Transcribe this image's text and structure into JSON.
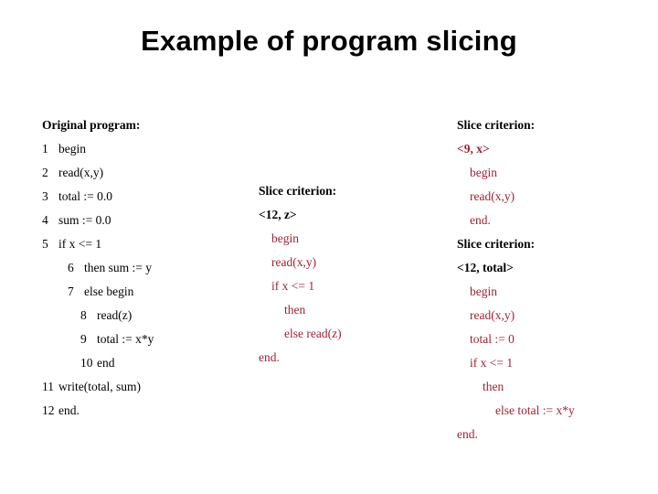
{
  "slide": {
    "title": "Example of program slicing",
    "background_color": "#ffffff",
    "text_color": "#000000",
    "slice_color": "#9b2335"
  },
  "original": {
    "heading": "Original program:",
    "lines": [
      {
        "no": "1",
        "text": "begin",
        "indent": 0
      },
      {
        "no": "2",
        "text": "read(x,y)",
        "indent": 0
      },
      {
        "no": "3",
        "text": "total := 0.0",
        "indent": 0
      },
      {
        "no": "4",
        "text": "sum := 0.0",
        "indent": 0
      },
      {
        "no": "5",
        "text": "if x <= 1",
        "indent": 0
      },
      {
        "no": "6",
        "text": "then sum := y",
        "indent": 2
      },
      {
        "no": "7",
        "text": "else begin",
        "indent": 2
      },
      {
        "no": "8",
        "text": "read(z)",
        "indent": 3
      },
      {
        "no": "9",
        "text": "total := x*y",
        "indent": 3
      },
      {
        "no": "10",
        "text": "end",
        "indent": 3
      },
      {
        "no": "11",
        "text": "write(total, sum)",
        "indent": 0
      },
      {
        "no": "12",
        "text": "end.",
        "indent": 0
      }
    ]
  },
  "slice_middle": {
    "heading": "Slice criterion:",
    "criterion": "<12, z>",
    "lines": [
      {
        "text": "begin",
        "indent": 1
      },
      {
        "text": "read(x,y)",
        "indent": 1
      },
      {
        "text": "if x <= 1",
        "indent": 1
      },
      {
        "text": "then",
        "indent": 2
      },
      {
        "text": "else read(z)",
        "indent": 2
      },
      {
        "text": "end.",
        "indent": 0
      }
    ]
  },
  "slice_top_right": {
    "heading": "Slice criterion:",
    "criterion": "<9, x>",
    "lines": [
      {
        "text": "begin",
        "indent": 1
      },
      {
        "text": "read(x,y)",
        "indent": 1
      },
      {
        "text": "end.",
        "indent": 1
      }
    ]
  },
  "slice_bottom_right": {
    "heading": "Slice criterion:",
    "criterion": "<12, total>",
    "lines": [
      {
        "text": "begin",
        "indent": 1
      },
      {
        "text": "read(x,y)",
        "indent": 1
      },
      {
        "text": "total := 0",
        "indent": 1
      },
      {
        "text": "if x <= 1",
        "indent": 1
      },
      {
        "text": "then",
        "indent": 2
      },
      {
        "text": "else total := x*y",
        "indent": 3
      },
      {
        "text": "end.",
        "indent": 0
      }
    ]
  }
}
